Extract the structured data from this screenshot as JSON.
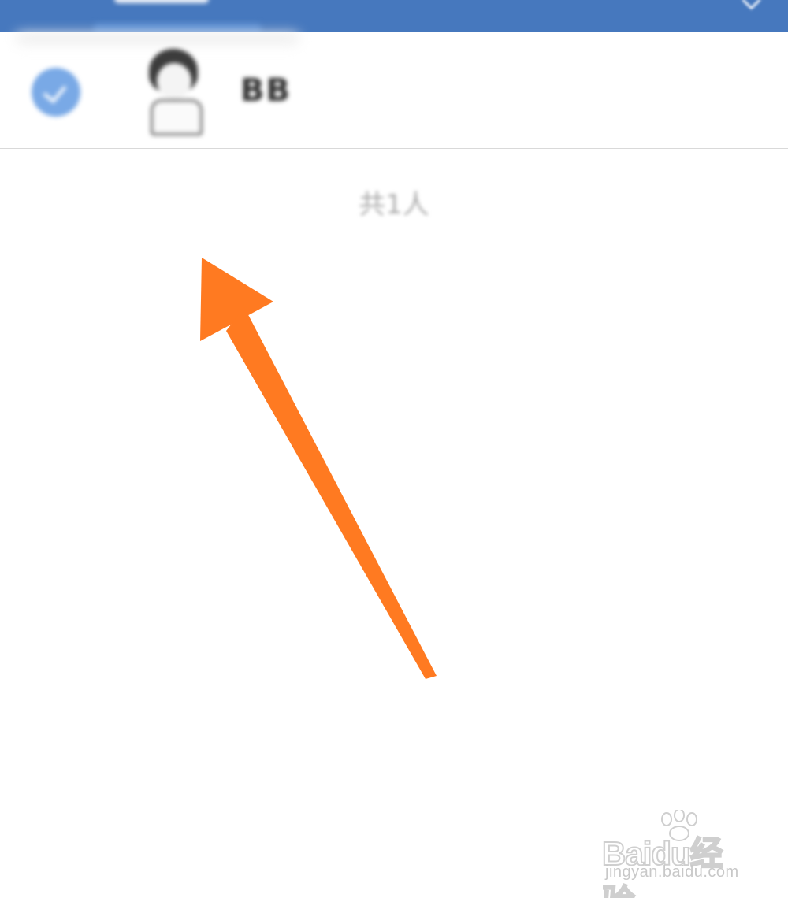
{
  "header": {
    "background_color": "#4678be"
  },
  "member": {
    "name": "BB",
    "selected": true,
    "check_color": "#79a9e6"
  },
  "summary": {
    "count_text": "共1人"
  },
  "annotation": {
    "arrow_color": "#ff7a21"
  },
  "watermark": {
    "brand": "Baidu经验",
    "url": "jingyan.baidu.com"
  }
}
